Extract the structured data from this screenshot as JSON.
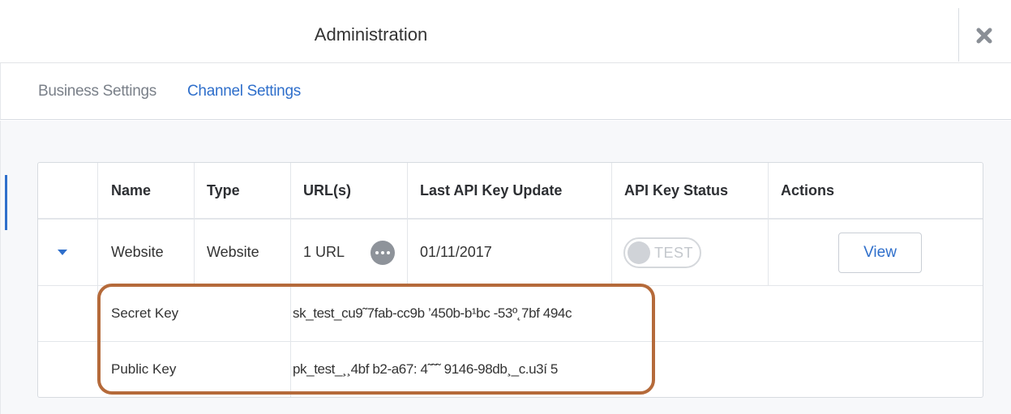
{
  "header": {
    "title": "Administration",
    "close_icon": "close-icon"
  },
  "tabs": [
    {
      "label": "Business Settings",
      "active": false
    },
    {
      "label": "Channel Settings",
      "active": true
    }
  ],
  "colors": {
    "accent": "#2f6fcb",
    "highlight_border": "#b56a3a",
    "muted_text": "#7a8089"
  },
  "table": {
    "columns": [
      "",
      "Name",
      "Type",
      "URL(s)",
      "Last API Key Update",
      "API Key Status",
      "Actions"
    ],
    "rows": [
      {
        "name": "Website",
        "type": "Website",
        "urls": "1 URL",
        "last_update": "01/11/2017",
        "status_toggle": "TEST",
        "action": "View"
      }
    ],
    "details": [
      {
        "label": "Secret Key",
        "value": "sk_test_cu9˜7fab-cc9b ’450b-b¹bc -53º˛7bf 494c"
      },
      {
        "label": "Public Key",
        "value": "pk_test_¸¸4bf b2-a67: 4˜˜˜ 9146-98db¸_c.u3í 5"
      }
    ]
  }
}
